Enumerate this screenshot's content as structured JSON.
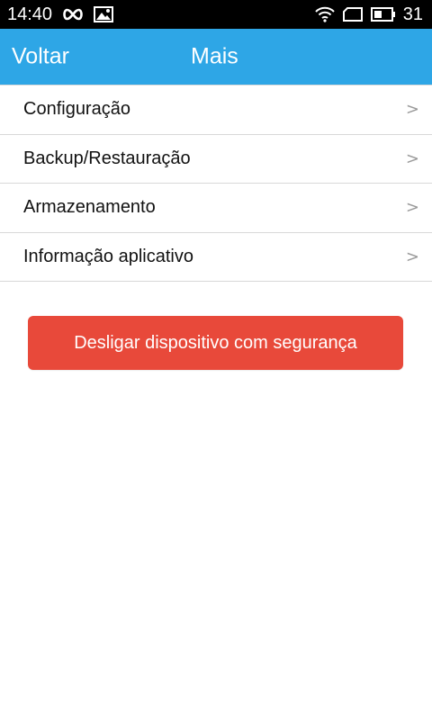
{
  "status_bar": {
    "time": "14:40",
    "battery_level": "31"
  },
  "header": {
    "back_label": "Voltar",
    "title": "Mais"
  },
  "menu": {
    "items": [
      {
        "label": "Configuração",
        "chevron": ">"
      },
      {
        "label": "Backup/Restauração",
        "chevron": ">"
      },
      {
        "label": "Armazenamento",
        "chevron": ">"
      },
      {
        "label": "Informação aplicativo",
        "chevron": ">"
      }
    ]
  },
  "actions": {
    "shutdown_label": "Desligar dispositivo com segurança"
  },
  "colors": {
    "header_bg": "#2ea6e6",
    "shutdown_bg": "#e8493a"
  }
}
